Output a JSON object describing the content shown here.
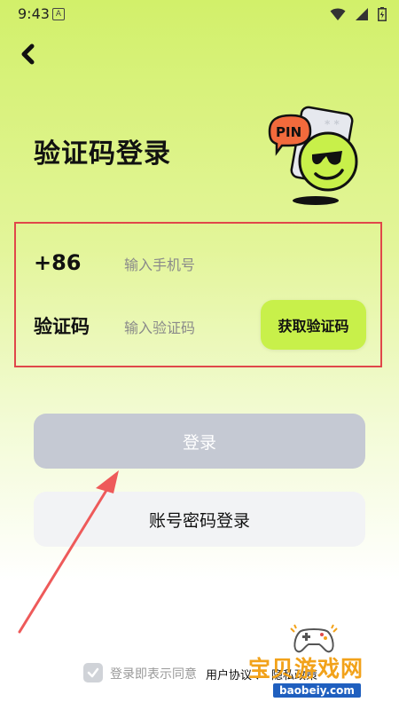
{
  "status_bar": {
    "time": "9:43",
    "notif_letter": "A"
  },
  "header": {
    "title": "验证码登录"
  },
  "mascot": {
    "pin_label": "PIN"
  },
  "form": {
    "phone_prefix": "+86",
    "phone_placeholder": "输入手机号",
    "code_label": "验证码",
    "code_placeholder": "输入验证码",
    "get_code_label": "获取验证码"
  },
  "actions": {
    "login_label": "登录",
    "account_login_label": "账号密码登录"
  },
  "agreement": {
    "text": "登录即表示同意",
    "user_agreement": "用户协议",
    "separator": "、",
    "privacy_policy": "隐私政策"
  },
  "watermark": {
    "title": "宝贝游戏网",
    "url": "baobeiy.com"
  },
  "colors": {
    "accent": "#c8f04a",
    "highlight_box": "#e0474a",
    "disabled_button": "#c5c9d3"
  }
}
